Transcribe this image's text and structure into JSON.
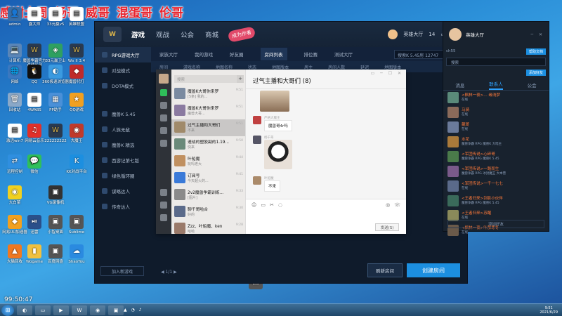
{
  "banner": [
    "感谢土周",
    "杨哥",
    "威哥",
    "混蛋哥",
    "伦哥"
  ],
  "desktop_icons": [
    {
      "label": "admin"
    },
    {
      "label": "露大师"
    },
    {
      "label": "33元赢v5"
    },
    {
      "label": "英雄联盟"
    },
    {
      "label": "DCCO..."
    },
    {
      "label": "计算机"
    },
    {
      "label": "魔兽争霸官方对战平台"
    },
    {
      "label": "33元赢卫士"
    },
    {
      "label": "Wx II 3.4"
    },
    {
      "label": "网络"
    },
    {
      "label": "QQ"
    },
    {
      "label": "360极速浏览器"
    },
    {
      "label": "魔兽代打"
    },
    {
      "label": "回收站"
    },
    {
      "label": "4WABS"
    },
    {
      "label": "PP助手"
    },
    {
      "label": "QQ游戏"
    },
    {
      "label": "激活win7"
    },
    {
      "label": "网易云音乐"
    },
    {
      "label": "222222222"
    },
    {
      "label": "大魔王"
    },
    {
      "label": "远程控制"
    },
    {
      "label": "微信"
    },
    {
      "label": "腾讯电脑管家"
    },
    {
      "label": "KK对战平台"
    },
    {
      "label": "大白菜"
    },
    {
      "label": "VG录像机"
    },
    {
      "label": "WeGame"
    },
    {
      "label": "Sublime"
    },
    {
      "label": "网易UU加速器"
    },
    {
      "label": "迅雷"
    },
    {
      "label": "小智桌面"
    },
    {
      "label": "QQ音乐"
    },
    {
      "label": "大猫回收"
    },
    {
      "label": "Wogame"
    },
    {
      "label": "百度网盘"
    },
    {
      "label": "ShaoYou"
    }
  ],
  "app": {
    "logo": "W",
    "nav": [
      "游戏",
      "观战",
      "公会",
      "商城"
    ],
    "badge": "成为作者",
    "user": "英雄大厅",
    "count": "14",
    "subnav": [
      "家族大厅",
      "我的游戏",
      "好友圈",
      "房间列表",
      "排位赛",
      "测试大厅"
    ],
    "search_placeholder": "搜索K 5.45房",
    "search_value": "12747",
    "cols": [
      "房间",
      "游戏名称",
      "地图名称",
      "状态",
      "地图版本",
      "房主",
      "房间人数",
      "延迟",
      "地图版本"
    ],
    "left_menu": [
      "RPG游戏大厅",
      "对战模式",
      "DOTA模式",
      "魔兽K 5.45",
      "人族无敌",
      "魔兽K 精选",
      "西游记第七版",
      "绿色循环圈",
      "谋略达人",
      "传奇达人"
    ],
    "join_label": "加入新游戏",
    "pager": "◀ 1/1 ▶",
    "refresh": "刷新房间",
    "create": "创建房间"
  },
  "chat": {
    "search": "搜索",
    "title": "过气主播和大哥们 (8)",
    "convs": [
      {
        "name": "魔兽K大哥你来罗",
        "preview": "[5条] 我的...",
        "time": "9:51"
      },
      {
        "name": "魔兽K大哥你来罗",
        "preview": "魔兽大哥...",
        "time": "9:51"
      },
      {
        "name": "过气主播和大哥们",
        "preview": "不来",
        "time": "9:51"
      },
      {
        "name": "速战的塑胶副的1.19...",
        "preview": "快来",
        "time": "9:50"
      },
      {
        "name": "叶船魔",
        "preview": "玩吗老大",
        "time": "9:44"
      },
      {
        "name": "订阅号",
        "preview": "今天超火的...",
        "time": "9:41"
      },
      {
        "name": "2v2魔兽争霸训练...",
        "preview": "[图片]",
        "time": "9:33"
      },
      {
        "name": "聊千哥啦合",
        "preview": "好的",
        "time": "9:30"
      },
      {
        "name": "Zzz、叶船魔、ken",
        "preview": "哈哈",
        "time": "9:28"
      }
    ],
    "messages": {
      "m1_name": "",
      "m2_name": "严格大魔王",
      "m2_text": "魔兽哥4r吗",
      "m3_name": "杨千哥",
      "m4_name": "叶船魔",
      "m4_text": "不来"
    },
    "send": "发送(S)"
  },
  "friends": {
    "name": "英雄大厅",
    "line": "ch55",
    "btn1": "帮助文档",
    "btn2": "添加好友",
    "search": "搜索",
    "tabs": [
      "消息",
      "联系人",
      "公会"
    ],
    "list": [
      {
        "name": "<枫林一夜>… 缘浅梦",
        "status": "在线"
      },
      {
        "name": "马骑",
        "status": "在线"
      },
      {
        "name": "藏哥",
        "status": "在线"
      },
      {
        "name": "水花",
        "status": "魔兽争霸 RPG 魔兽K 大暗主"
      },
      {
        "name": "<军团传说>心碎哥",
        "status": "魔兽争霸 RPG 魔兽K 5.45"
      },
      {
        "name": "<军团传说>一路而生",
        "status": "魔兽争霸 RPG 冰封魔王 大本营"
      },
      {
        "name": "<军团传说>一千一七七",
        "status": "在线"
      },
      {
        "name": "<王者归来>剑影小伙伴",
        "status": "魔兽争霸 RPG 魔兽K 5.45"
      },
      {
        "name": "<王者归来>苏醒",
        "status": "在线"
      },
      {
        "name": "<枫林一夜>叶那寒冬",
        "status": "在线"
      }
    ],
    "add": "添加好友"
  },
  "taskbar": {
    "clock_time": "9:51",
    "clock_date": "2021/6/29",
    "overlay_time": "99:50:47"
  }
}
